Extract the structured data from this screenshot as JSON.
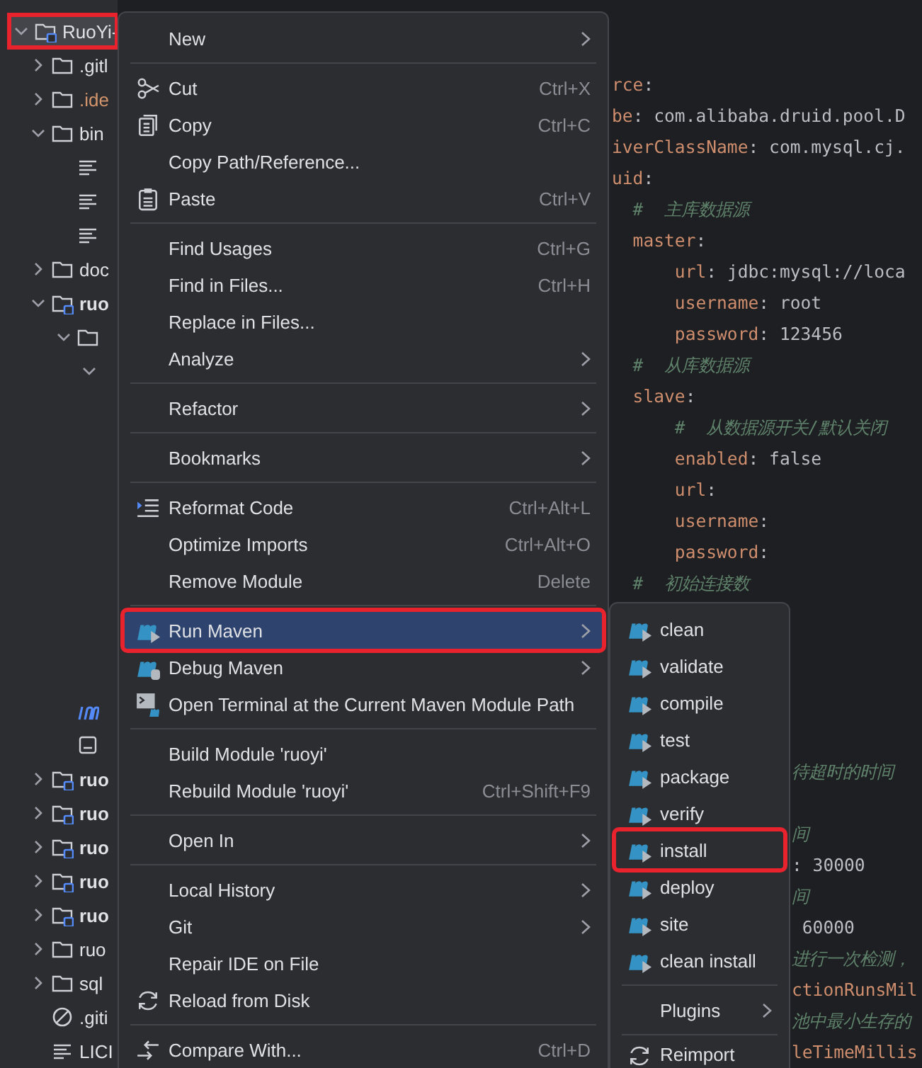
{
  "tree": {
    "items_top": [
      {
        "kind": "module",
        "label": "RuoYi-",
        "expanded": true,
        "selected": true,
        "marked": true,
        "children": [
          {
            "kind": "folder",
            "label": ".gitl",
            "expanded": false,
            "selected": false,
            "marked": false
          },
          {
            "kind": "excluded-folder",
            "label": ".ide",
            "expanded": false,
            "selected": false,
            "marked": false
          },
          {
            "kind": "folder",
            "label": "bin",
            "expanded": true,
            "selected": false,
            "marked": false,
            "children": [
              {
                "kind": "file",
                "selected": false,
                "marked": false
              },
              {
                "kind": "file",
                "selected": false,
                "marked": false
              },
              {
                "kind": "file",
                "selected": false,
                "marked": false
              }
            ]
          },
          {
            "kind": "folder",
            "label": "doc",
            "expanded": false,
            "selected": false,
            "marked": false
          },
          {
            "kind": "module",
            "label": "ruo",
            "bold": true,
            "expanded": true,
            "selected": false,
            "marked": false,
            "children": [
              {
                "kind": "folder",
                "expanded": true,
                "selected": false,
                "marked": false,
                "children": [
                  {
                    "expanded": true,
                    "selected": false,
                    "marked": false
                  }
                ]
              }
            ]
          }
        ]
      }
    ],
    "items_continued": [
      {
        "kind": "maven-file",
        "selected": false,
        "marked": false
      },
      {
        "kind": "file-box",
        "selected": false,
        "marked": false
      }
    ],
    "items_bottom": [
      {
        "kind": "module",
        "label": "ruo",
        "bold": true,
        "expanded": false,
        "selected": false,
        "marked": false
      },
      {
        "kind": "module",
        "label": "ruo",
        "bold": true,
        "expanded": false,
        "selected": false,
        "marked": false
      },
      {
        "kind": "module",
        "label": "ruo",
        "bold": true,
        "expanded": false,
        "selected": false,
        "marked": false
      },
      {
        "kind": "module",
        "label": "ruo",
        "bold": true,
        "expanded": false,
        "selected": false,
        "marked": false
      },
      {
        "kind": "module",
        "label": "ruo",
        "bold": true,
        "expanded": false,
        "selected": false,
        "marked": false
      },
      {
        "kind": "folder",
        "label": "ruo",
        "expanded": false,
        "selected": false,
        "marked": false
      },
      {
        "kind": "folder",
        "label": "sql",
        "expanded": false,
        "selected": false,
        "marked": false
      },
      {
        "kind": "ignored",
        "label": ".giti",
        "selected": false,
        "marked": false
      },
      {
        "kind": "file",
        "label": "LICI",
        "selected": false,
        "marked": false
      }
    ]
  },
  "editor": {
    "lines_top": [
      [
        {
          "kind": "key",
          "text": "rce"
        },
        {
          "kind": "plain",
          "text": ":"
        }
      ],
      [
        {
          "kind": "key",
          "text": "be"
        },
        {
          "kind": "plain",
          "text": ": com.alibaba.druid.pool.D"
        }
      ],
      [
        {
          "kind": "key",
          "text": "iverClassName"
        },
        {
          "kind": "plain",
          "text": ": com.mysql.cj."
        }
      ],
      [
        {
          "kind": "key",
          "text": "uid"
        },
        {
          "kind": "plain",
          "text": ":"
        }
      ],
      [
        {
          "kind": "comment",
          "text": "  #  主库数据源"
        }
      ],
      [
        {
          "kind": "key",
          "text": "  master"
        },
        {
          "kind": "plain",
          "text": ":"
        }
      ],
      [
        {
          "kind": "key",
          "text": "      url"
        },
        {
          "kind": "plain",
          "text": ": jdbc:mysql://loca"
        }
      ],
      [
        {
          "kind": "key",
          "text": "      username"
        },
        {
          "kind": "plain",
          "text": ": root"
        }
      ],
      [
        {
          "kind": "key",
          "text": "      password"
        },
        {
          "kind": "plain",
          "text": ": 123456"
        }
      ],
      [
        {
          "kind": "comment",
          "text": "  #  从库数据源"
        }
      ],
      [
        {
          "kind": "key",
          "text": "  slave"
        },
        {
          "kind": "plain",
          "text": ":"
        }
      ],
      [
        {
          "kind": "comment",
          "text": "      #  从数据源开关/默认关闭"
        }
      ],
      [
        {
          "kind": "key",
          "text": "      enabled"
        },
        {
          "kind": "plain",
          "text": ": false"
        }
      ],
      [
        {
          "kind": "key",
          "text": "      url"
        },
        {
          "kind": "plain",
          "text": ":"
        }
      ],
      [
        {
          "kind": "key",
          "text": "      username"
        },
        {
          "kind": "plain",
          "text": ":"
        }
      ],
      [
        {
          "kind": "key",
          "text": "      password"
        },
        {
          "kind": "plain",
          "text": ":"
        }
      ],
      [
        {
          "kind": "comment",
          "text": "  #  初始连接数"
        }
      ]
    ],
    "lines_side": [
      [
        {
          "kind": "comment",
          "text": "待超时的时间"
        }
      ],
      [
        {
          "kind": "comment",
          "text": "间"
        }
      ],
      [
        {
          "kind": "plain",
          "text": ": 30000"
        }
      ],
      [
        {
          "kind": "comment",
          "text": "间"
        }
      ],
      [
        {
          "kind": "plain",
          "text": " 60000"
        }
      ],
      [
        {
          "kind": "comment",
          "text": "进行一次检测，"
        }
      ],
      [
        {
          "kind": "key",
          "text": "ctionRunsMil"
        }
      ],
      [
        {
          "kind": "comment",
          "text": "池中最小生存的"
        }
      ],
      [
        {
          "kind": "key",
          "text": "leTimeMillis"
        }
      ]
    ]
  },
  "context_menu": {
    "groups": [
      [
        {
          "label": "New",
          "submenu": true,
          "selected": false,
          "marked": false
        }
      ],
      [
        {
          "label": "Cut",
          "kind": "scissors",
          "shortcut": "Ctrl+X",
          "selected": false,
          "marked": false
        },
        {
          "label": "Copy",
          "kind": "copy",
          "shortcut": "Ctrl+C",
          "selected": false,
          "marked": false
        },
        {
          "label": "Copy Path/Reference...",
          "selected": false,
          "marked": false
        },
        {
          "label": "Paste",
          "kind": "paste",
          "shortcut": "Ctrl+V",
          "selected": false,
          "marked": false
        }
      ],
      [
        {
          "label": "Find Usages",
          "shortcut": "Ctrl+G",
          "selected": false,
          "marked": false
        },
        {
          "label": "Find in Files...",
          "shortcut": "Ctrl+H",
          "selected": false,
          "marked": false
        },
        {
          "label": "Replace in Files...",
          "selected": false,
          "marked": false
        },
        {
          "label": "Analyze",
          "submenu": true,
          "selected": false,
          "marked": false
        }
      ],
      [
        {
          "label": "Refactor",
          "submenu": true,
          "selected": false,
          "marked": false
        }
      ],
      [
        {
          "label": "Bookmarks",
          "submenu": true,
          "selected": false,
          "marked": false
        }
      ],
      [
        {
          "label": "Reformat Code",
          "kind": "reformat",
          "shortcut": "Ctrl+Alt+L",
          "selected": false,
          "marked": false
        },
        {
          "label": "Optimize Imports",
          "shortcut": "Ctrl+Alt+O",
          "selected": false,
          "marked": false
        },
        {
          "label": "Remove Module",
          "shortcut": "Delete",
          "selected": false,
          "marked": false
        }
      ],
      [
        {
          "label": "Run Maven",
          "kind": "maven-run",
          "submenu": true,
          "selected": true,
          "marked": true
        },
        {
          "label": "Debug Maven",
          "kind": "maven-debug",
          "submenu": true,
          "selected": false,
          "marked": false
        },
        {
          "label": "Open Terminal at the Current Maven Module Path",
          "kind": "terminal",
          "selected": false,
          "marked": false
        }
      ],
      [
        {
          "label": "Build Module 'ruoyi'",
          "selected": false,
          "marked": false
        },
        {
          "label": "Rebuild Module 'ruoyi'",
          "shortcut": "Ctrl+Shift+F9",
          "selected": false,
          "marked": false
        }
      ],
      [
        {
          "label": "Open In",
          "submenu": true,
          "selected": false,
          "marked": false
        }
      ],
      [
        {
          "label": "Local History",
          "submenu": true,
          "selected": false,
          "marked": false
        },
        {
          "label": "Git",
          "submenu": true,
          "selected": false,
          "marked": false
        },
        {
          "label": "Repair IDE on File",
          "selected": false,
          "marked": false
        },
        {
          "label": "Reload from Disk",
          "kind": "reload",
          "selected": false,
          "marked": false
        }
      ],
      [
        {
          "label": "Compare With...",
          "kind": "compare",
          "shortcut": "Ctrl+D",
          "selected": false,
          "marked": false
        }
      ]
    ]
  },
  "maven_submenu": {
    "groups": [
      [
        {
          "label": "clean",
          "kind": "maven-run",
          "selected": false,
          "marked": false
        },
        {
          "label": "validate",
          "kind": "maven-run",
          "selected": false,
          "marked": false
        },
        {
          "label": "compile",
          "kind": "maven-run",
          "selected": false,
          "marked": false
        },
        {
          "label": "test",
          "kind": "maven-run",
          "selected": false,
          "marked": false
        },
        {
          "label": "package",
          "kind": "maven-run",
          "selected": false,
          "marked": false
        },
        {
          "label": "verify",
          "kind": "maven-run",
          "selected": false,
          "marked": false
        },
        {
          "label": "install",
          "kind": "maven-run",
          "selected": false,
          "marked": true
        },
        {
          "label": "deploy",
          "kind": "maven-run",
          "selected": false,
          "marked": false
        },
        {
          "label": "site",
          "kind": "maven-run",
          "selected": false,
          "marked": false
        },
        {
          "label": "clean install",
          "kind": "maven-run",
          "selected": false,
          "marked": false
        }
      ],
      [
        {
          "label": "Plugins",
          "submenu": true,
          "selected": false,
          "marked": false
        }
      ],
      [
        {
          "label": "Reimport",
          "kind": "reload",
          "selected": false,
          "marked": false
        }
      ]
    ]
  }
}
